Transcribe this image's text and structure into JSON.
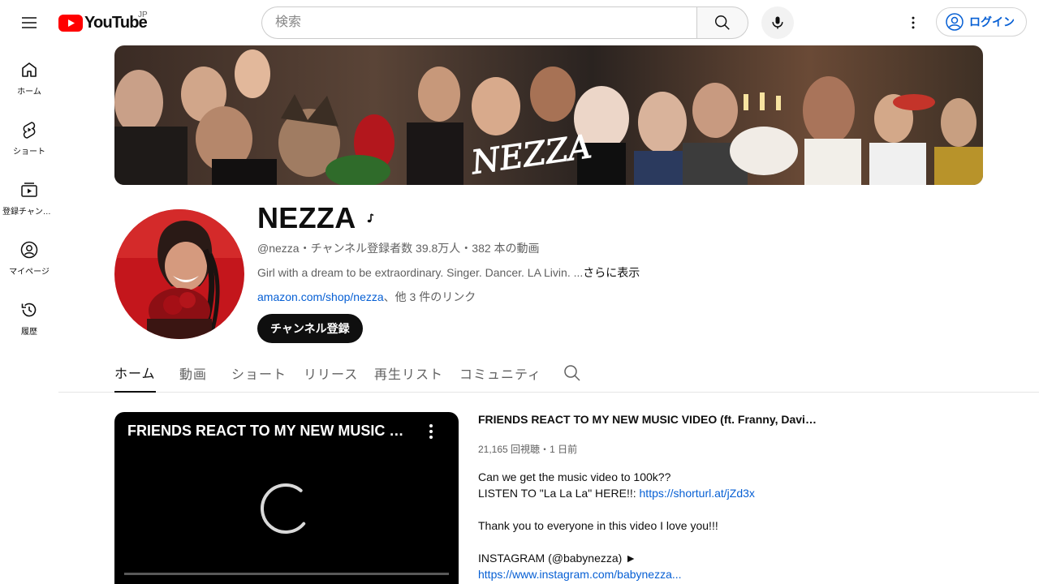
{
  "header": {
    "logo_text": "YouTube",
    "region": "JP",
    "search_placeholder": "検索",
    "login_label": "ログイン"
  },
  "sidebar": {
    "items": [
      {
        "label": "ホーム",
        "icon": "home-icon"
      },
      {
        "label": "ショート",
        "icon": "shorts-icon"
      },
      {
        "label": "登録チャンネル",
        "icon": "subscriptions-icon"
      },
      {
        "label": "マイページ",
        "icon": "you-icon"
      },
      {
        "label": "履歴",
        "icon": "history-icon"
      }
    ]
  },
  "banner": {
    "text": "NEZZA"
  },
  "channel": {
    "name": "NEZZA",
    "handle": "@nezza",
    "subscribers": "チャンネル登録者数 39.8万人",
    "video_count": "382 本の動画",
    "separator": "・",
    "description": "Girl with a dream to be extraordinary. Singer. Dancer. LA Livin. ...",
    "more_label": "さらに表示",
    "link_text": "amazon.com/shop/nezza",
    "link_suffix": "、他 3 件のリンク",
    "subscribe_label": "チャンネル登録"
  },
  "tabs": [
    {
      "label": "ホーム",
      "active": true
    },
    {
      "label": "動画"
    },
    {
      "label": "ショート"
    },
    {
      "label": "リリース"
    },
    {
      "label": "再生リスト"
    },
    {
      "label": "コミュニティ"
    }
  ],
  "featured": {
    "player_title": "FRIENDS REACT TO MY NEW MUSIC VIDEO (ft. Franny, Davidal...",
    "title": "FRIENDS REACT TO MY NEW MUSIC VIDEO (ft. Franny, Davidal...",
    "views": "21,165 回視聴",
    "dot": "・",
    "age": "1 日前",
    "description_lines": [
      {
        "text": "Can we get the music video to 100k??"
      },
      {
        "text": "LISTEN TO \"La La La\" HERE!!: ",
        "link": "https://shorturl.at/jZd3x"
      },
      {
        "text": ""
      },
      {
        "text": "Thank you to everyone in this video I love you!!!"
      },
      {
        "text": ""
      },
      {
        "text": "INSTAGRAM (@babynezza) ►"
      },
      {
        "text": "",
        "link": "https://www.instagram.com/babynezza..."
      }
    ]
  },
  "colors": {
    "accent_red": "#ff0000",
    "link_blue": "#065fd4",
    "text_secondary": "#606060"
  }
}
